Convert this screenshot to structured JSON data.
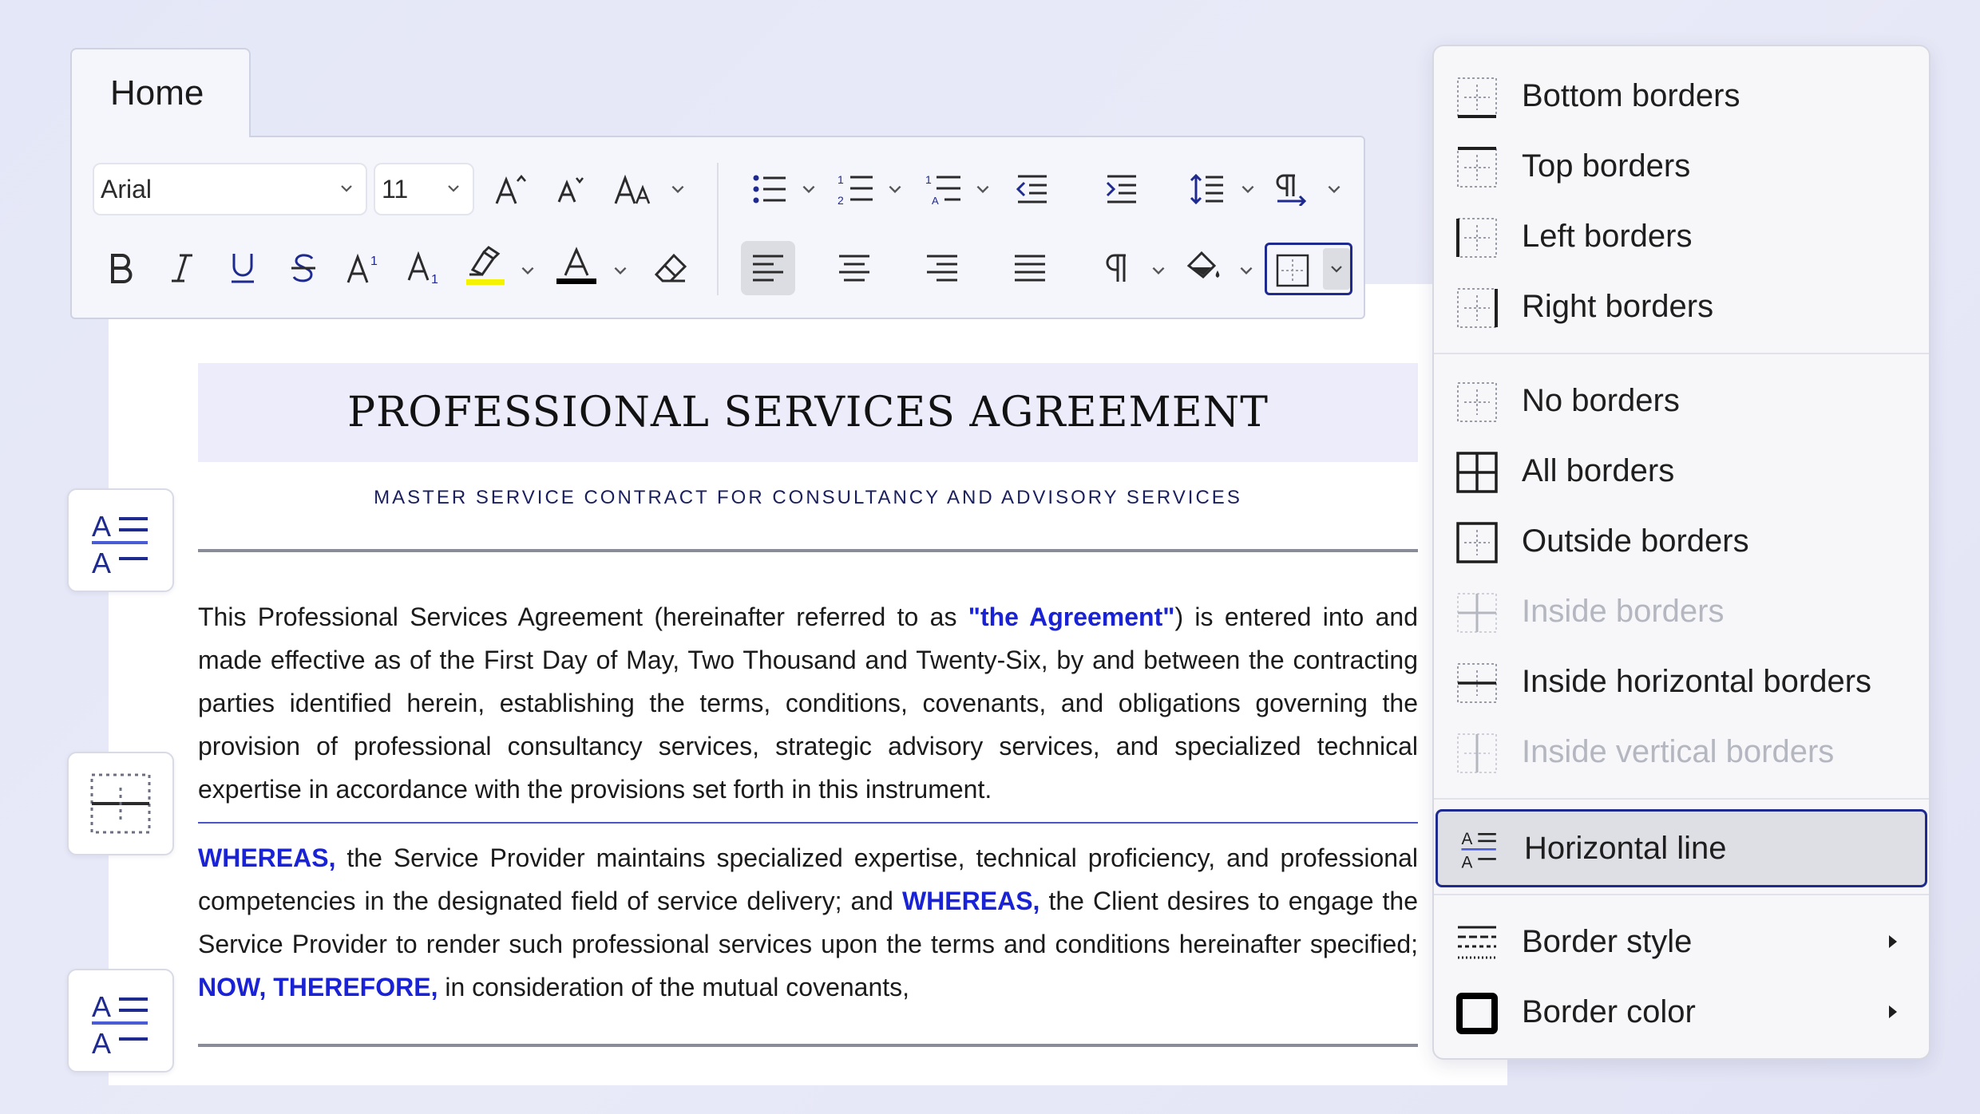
{
  "ribbon": {
    "tab_label": "Home",
    "font_family": "Arial",
    "font_size": "11",
    "highlight_color": "#f4f200",
    "font_color": "#000000"
  },
  "document": {
    "title": "PROFESSIONAL SERVICES AGREEMENT",
    "subtitle": "MASTER SERVICE CONTRACT FOR CONSULTANCY AND ADVISORY SERVICES",
    "p1_a": "This Professional Services Agreement (hereinafter referred to as ",
    "p1_hl": "\"the Agreement\"",
    "p1_b": ") is entered into and made effective as of the First Day of May, Two Thousand and Twenty-Six, by and between the contracting parties identified herein, establishing the terms, conditions, covenants, and obligations governing the provision of professional consultancy services, strategic advisory services, and specialized technical expertise in accordance with the provisions set forth in this instrument.",
    "p2_hl1": "WHEREAS,",
    "p2_a": " the Service Provider maintains specialized expertise, technical proficiency, and professional competencies in the designated field of service delivery; and ",
    "p2_hl2": "WHEREAS,",
    "p2_b": " the Client desires to engage the Service Provider to render such professional services upon the terms and conditions hereinafter specified; ",
    "p2_hl3": "NOW, THEREFORE,",
    "p2_c": " in consideration of the mutual covenants,",
    "accent_color": "#1a22d6"
  },
  "menu": {
    "items": [
      {
        "label": "Bottom borders",
        "icon": "border-bottom-icon",
        "enabled": true
      },
      {
        "label": "Top borders",
        "icon": "border-top-icon",
        "enabled": true
      },
      {
        "label": "Left borders",
        "icon": "border-left-icon",
        "enabled": true
      },
      {
        "label": "Right borders",
        "icon": "border-right-icon",
        "enabled": true
      },
      {
        "label": "No borders",
        "icon": "border-none-icon",
        "enabled": true
      },
      {
        "label": "All borders",
        "icon": "border-all-icon",
        "enabled": true
      },
      {
        "label": "Outside borders",
        "icon": "border-outside-icon",
        "enabled": true
      },
      {
        "label": "Inside borders",
        "icon": "border-inside-icon",
        "enabled": false
      },
      {
        "label": "Inside horizontal borders",
        "icon": "border-inside-horizontal-icon",
        "enabled": true
      },
      {
        "label": "Inside vertical borders",
        "icon": "border-inside-vertical-icon",
        "enabled": false
      },
      {
        "label": "Horizontal line",
        "icon": "horizontal-line-icon",
        "enabled": true,
        "selected": true
      },
      {
        "label": "Border style",
        "icon": "border-style-icon",
        "enabled": true,
        "submenu": true
      },
      {
        "label": "Border color",
        "icon": "border-color-icon",
        "enabled": true,
        "submenu": true
      }
    ]
  }
}
